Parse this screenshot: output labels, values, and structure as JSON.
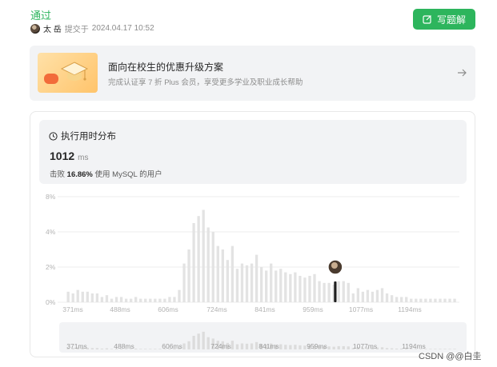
{
  "submission": {
    "status": "通过",
    "author": "太 岳",
    "submitted_label": "提交于",
    "date": "2024.04.17 10:52"
  },
  "write_button": {
    "label": "写题解",
    "icon": "edit-icon"
  },
  "promo": {
    "title": "面向在校生的优惠升级方案",
    "subtitle": "完成认证享 7 折 Plus 会员，享受更多学业及职业成长帮助",
    "icon": "graduation-cap-icon"
  },
  "runtime": {
    "title": "执行用时分布",
    "value": "1012",
    "unit": "ms",
    "beats_prefix": "击败",
    "beats_percent": "16.86%",
    "beats_suffix": "使用 MySQL 的用户"
  },
  "chart_data": {
    "type": "bar",
    "y_ticks": [
      "8%",
      "4%",
      "2%",
      "0%"
    ],
    "ylim": [
      0,
      8
    ],
    "x_tick_labels": [
      "371ms",
      "488ms",
      "606ms",
      "724ms",
      "841ms",
      "959ms",
      "1077ms",
      "1194ms"
    ],
    "x_ticks": [
      371,
      488,
      606,
      724,
      841,
      959,
      1077,
      1194
    ],
    "bin_width_ms": 11.8,
    "x_start_ms": 336,
    "values": [
      0.2,
      0.3,
      0.6,
      0.5,
      0.7,
      0.6,
      0.6,
      0.5,
      0.5,
      0.3,
      0.4,
      0.2,
      0.3,
      0.3,
      0.2,
      0.2,
      0.3,
      0.2,
      0.2,
      0.2,
      0.2,
      0.2,
      0.2,
      0.3,
      0.3,
      0.7,
      2.2,
      3.0,
      5.0,
      5.8,
      6.5,
      4.5,
      4.0,
      3.2,
      3.0,
      2.4,
      3.2,
      1.9,
      2.2,
      2.1,
      2.2,
      2.7,
      2.0,
      1.8,
      2.2,
      1.8,
      1.9,
      1.7,
      1.6,
      1.7,
      1.5,
      1.4,
      1.5,
      1.6,
      1.2,
      1.1,
      1.1,
      1.0,
      1.2,
      1.2,
      1.1,
      0.5,
      0.8,
      0.6,
      0.7,
      0.6,
      0.7,
      0.8,
      0.5,
      0.4,
      0.3,
      0.3,
      0.3,
      0.2,
      0.2,
      0.2,
      0.2,
      0.2,
      0.2,
      0.2,
      0.2,
      0.2,
      0.2,
      0.2,
      0.2,
      0.2
    ],
    "highlight_ms": 1012,
    "colors": {
      "bar": "#e3e3e3",
      "highlight": "#1f1f1f",
      "grid": "#ececec",
      "axis_text": "#b3b3b3",
      "overview_bg": "#f2f3f5"
    }
  },
  "watermark": "CSDN @@白圭"
}
